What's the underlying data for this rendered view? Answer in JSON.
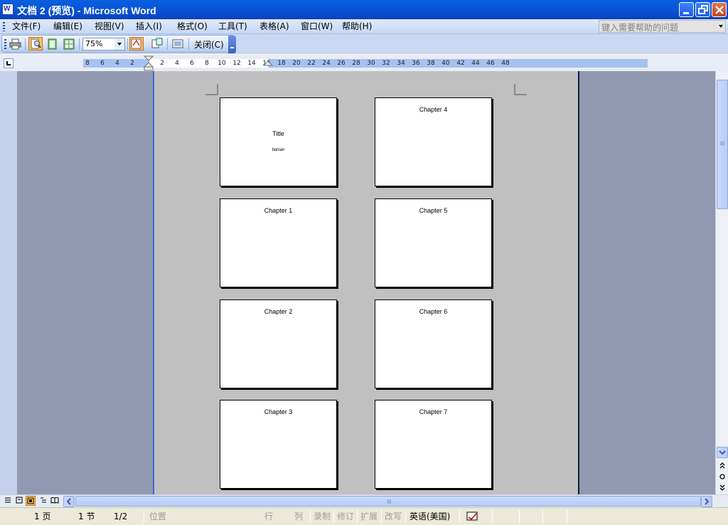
{
  "window": {
    "title": "文档 2 (预览) - Microsoft Word",
    "icon_letter": "W"
  },
  "menu": {
    "items": [
      "文件(F)",
      "编辑(E)",
      "视图(V)",
      "插入(I)",
      "格式(O)",
      "工具(T)",
      "表格(A)",
      "窗口(W)",
      "帮助(H)"
    ],
    "help_placeholder": "键入需要帮助的问题"
  },
  "toolbar": {
    "zoom_value": "75%",
    "close_label": "关闭(C)",
    "icons": [
      "print-icon",
      "magnifier-icon",
      "one-page-icon",
      "multiple-pages-icon",
      "shrink-to-fit-icon",
      "full-screen-icon"
    ]
  },
  "ruler": {
    "numbers": [
      "8",
      "6",
      "4",
      "2",
      "2",
      "4",
      "6",
      "8",
      "10",
      "12",
      "14",
      "16",
      "18",
      "20",
      "22",
      "24",
      "26",
      "28",
      "30",
      "32",
      "34",
      "36",
      "38",
      "40",
      "42",
      "44",
      "46",
      "48"
    ]
  },
  "document": {
    "pages": [
      {
        "title": "Title",
        "subtitle": "banian"
      },
      {
        "title": "Chapter 1"
      },
      {
        "title": "Chapter 2"
      },
      {
        "title": "Chapter 3"
      },
      {
        "title": "Chapter 4"
      },
      {
        "title": "Chapter 5"
      },
      {
        "title": "Chapter 6"
      },
      {
        "title": "Chapter 7"
      }
    ]
  },
  "status": {
    "page": "1 页",
    "section": "1 节",
    "page_of": "1/2",
    "position": "位置",
    "line": "行",
    "column": "列",
    "rec": "录制",
    "trk": "修订",
    "ext": "扩展",
    "ovr": "改写",
    "language": "英语(美国)"
  }
}
